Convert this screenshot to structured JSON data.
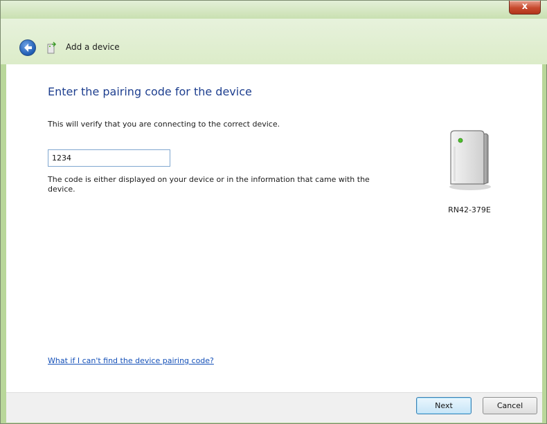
{
  "window": {
    "close_label": "x",
    "title": "Add a device"
  },
  "page": {
    "heading": "Enter the pairing code for the device",
    "verify_text": "This will verify that you are connecting to the correct device.",
    "code_input": {
      "value": "1234"
    },
    "hint_text": "The code is either displayed on your device or in the information that came with the device.",
    "device": {
      "name": "RN42-379E",
      "icon": "bluetooth-device-icon"
    },
    "help_link": "What if I can't find the device pairing code?"
  },
  "footer": {
    "next_label": "Next",
    "cancel_label": "Cancel"
  },
  "colors": {
    "heading": "#1e3f8f",
    "link": "#1450b8",
    "frame": "#b9d79a"
  }
}
